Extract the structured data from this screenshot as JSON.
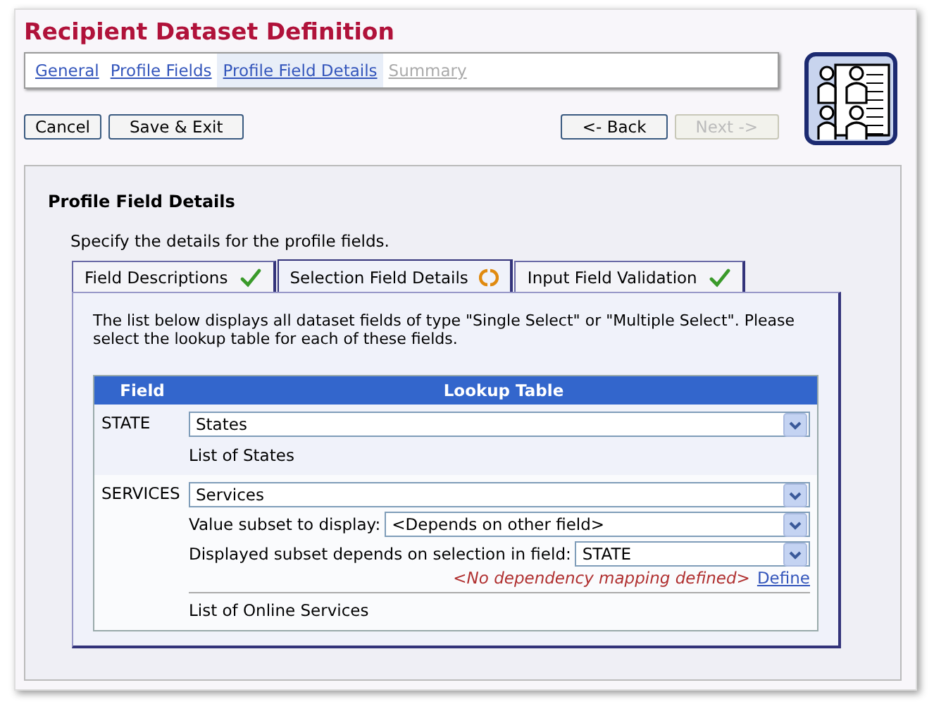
{
  "page": {
    "title": "Recipient Dataset Definition"
  },
  "wizard_steps": [
    {
      "label": "General",
      "selected": false,
      "disabled": false
    },
    {
      "label": "Profile Fields",
      "selected": false,
      "disabled": false
    },
    {
      "label": "Profile Field Details",
      "selected": true,
      "disabled": false
    },
    {
      "label": "Summary",
      "selected": false,
      "disabled": true
    }
  ],
  "left_buttons": [
    {
      "label": "Cancel",
      "disabled": false
    },
    {
      "label": "Save & Exit",
      "disabled": false
    }
  ],
  "right_buttons": [
    {
      "label": "<- Back",
      "disabled": false
    },
    {
      "label": "Next ->",
      "disabled": true
    }
  ],
  "section": {
    "heading": "Profile Field Details",
    "intro": "Specify the details for the profile fields."
  },
  "tabs": [
    {
      "label": "Field Descriptions",
      "selected": false,
      "kind": "done"
    },
    {
      "label": "Selection Field Details",
      "selected": true,
      "kind": "pending"
    },
    {
      "label": "Input Field Validation",
      "selected": false,
      "kind": "done"
    }
  ],
  "tab_text": "The list below displays all dataset fields of type \"Single Select\" or \"Multiple Select\". Please select the lookup table for each of these fields.",
  "table": {
    "columns": [
      "Field",
      "Lookup Table"
    ],
    "rows": [
      {
        "field": "STATE",
        "lookup": "States",
        "description": "List of States"
      },
      {
        "field": "SERVICES",
        "lookup": "Services",
        "options": [
          {
            "label": "Value subset to display:",
            "value": "<Depends on other field>"
          },
          {
            "label": "Displayed subset depends on selection in field:",
            "value": "STATE"
          }
        ],
        "note": "<No dependency mapping defined>",
        "note_link": "Define",
        "description": "List of Online Services"
      }
    ]
  }
}
